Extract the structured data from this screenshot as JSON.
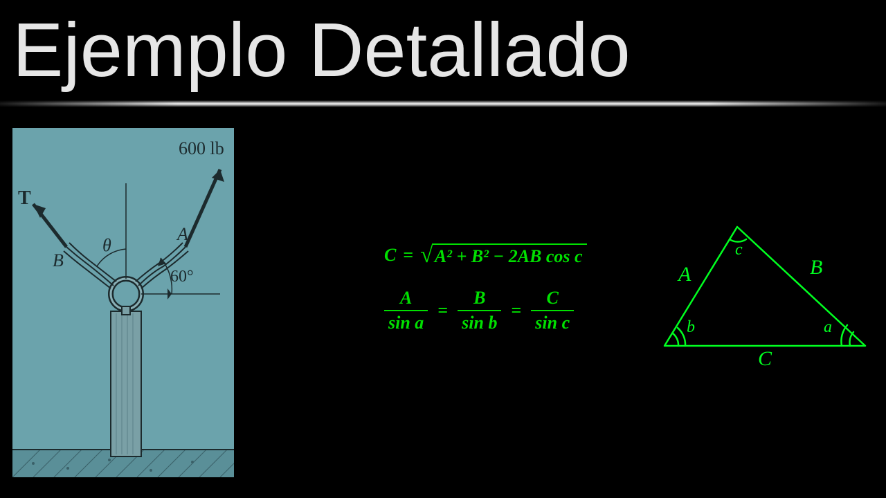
{
  "title": "Ejemplo Detallado",
  "figure": {
    "force_label": "600 lb",
    "tension_label": "T",
    "rope_a_label": "A",
    "rope_b_label": "B",
    "angle_theta": "θ",
    "angle_value": "60°"
  },
  "formulas": {
    "cosine_lhs": "C",
    "cosine_eq": "=",
    "cosine_rhs_inner": "A² + B² − 2AB cos c",
    "sine_A": "A",
    "sine_a": "sin a",
    "sine_B": "B",
    "sine_b": "sin b",
    "sine_C": "C",
    "sine_c": "sin c",
    "equals": "="
  },
  "triangle": {
    "side_A": "A",
    "side_B": "B",
    "side_C": "C",
    "angle_a": "a",
    "angle_b": "b",
    "angle_c": "c"
  }
}
